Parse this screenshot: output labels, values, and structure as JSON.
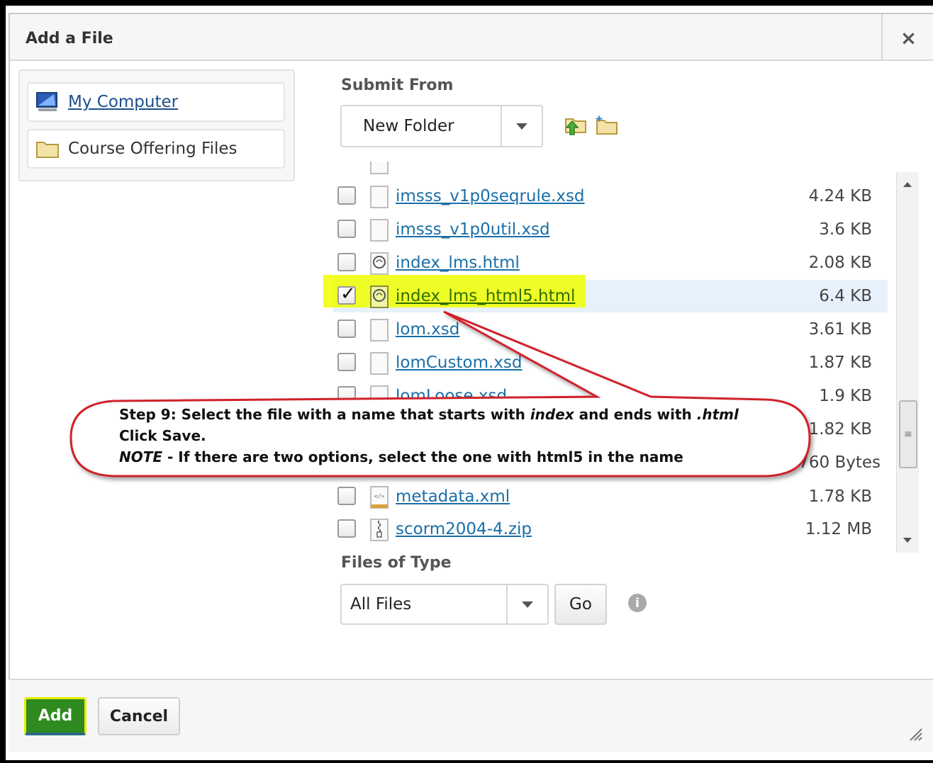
{
  "dialog": {
    "title": "Add a File",
    "close_glyph": "×"
  },
  "sources": [
    {
      "label": "My Computer",
      "icon": "computer-icon"
    },
    {
      "label": "Course Offering Files",
      "icon": "folder-icon"
    }
  ],
  "submit_from": {
    "label": "Submit From",
    "selected": "New Folder"
  },
  "files": [
    {
      "name": "imsss_v1p0seqrule.xsd",
      "size": "4.24 KB",
      "icon": "blank-file-icon",
      "checked": false
    },
    {
      "name": "imsss_v1p0util.xsd",
      "size": "3.6 KB",
      "icon": "blank-file-icon",
      "checked": false
    },
    {
      "name": "index_lms.html",
      "size": "2.08 KB",
      "icon": "html-file-icon",
      "checked": false
    },
    {
      "name": "index_lms_html5.html",
      "size": "6.4 KB",
      "icon": "html-file-icon",
      "checked": true
    },
    {
      "name": "lom.xsd",
      "size": "3.61 KB",
      "icon": "blank-file-icon",
      "checked": false
    },
    {
      "name": "lomCustom.xsd",
      "size": "1.87 KB",
      "icon": "blank-file-icon",
      "checked": false
    },
    {
      "name": "lomLoose.xsd",
      "size": "1.9 KB",
      "icon": "blank-file-icon",
      "checked": false
    },
    {
      "name": "",
      "size": "1.82 KB",
      "icon": "blank-file-icon",
      "checked": false
    },
    {
      "name": "",
      "size": "760 Bytes",
      "icon": "blank-file-icon",
      "checked": false
    },
    {
      "name": "metadata.xml",
      "size": "1.78 KB",
      "icon": "xml-file-icon",
      "checked": false
    },
    {
      "name": "scorm2004-4.zip",
      "size": "1.12 MB",
      "icon": "zip-file-icon",
      "checked": false
    }
  ],
  "files_of_type": {
    "label": "Files of Type",
    "selected": "All Files",
    "go_label": "Go",
    "info_glyph": "i"
  },
  "callout": {
    "line1_a": "Step 9: Select the file with a name that starts with ",
    "line1_b": "index",
    "line1_c": " and ends with ",
    "line1_d": ".html",
    "line2": "Click Save.",
    "line3_a": "NOTE",
    "line3_b": " - If there are two options, select the one with html5 in the name"
  },
  "footer": {
    "add_label": "Add",
    "cancel_label": "Cancel"
  },
  "colors": {
    "accent": "#2f8a1f",
    "link": "#1a6fa8",
    "highlight": "#f0ff00",
    "callout_border": "#d0202a"
  }
}
